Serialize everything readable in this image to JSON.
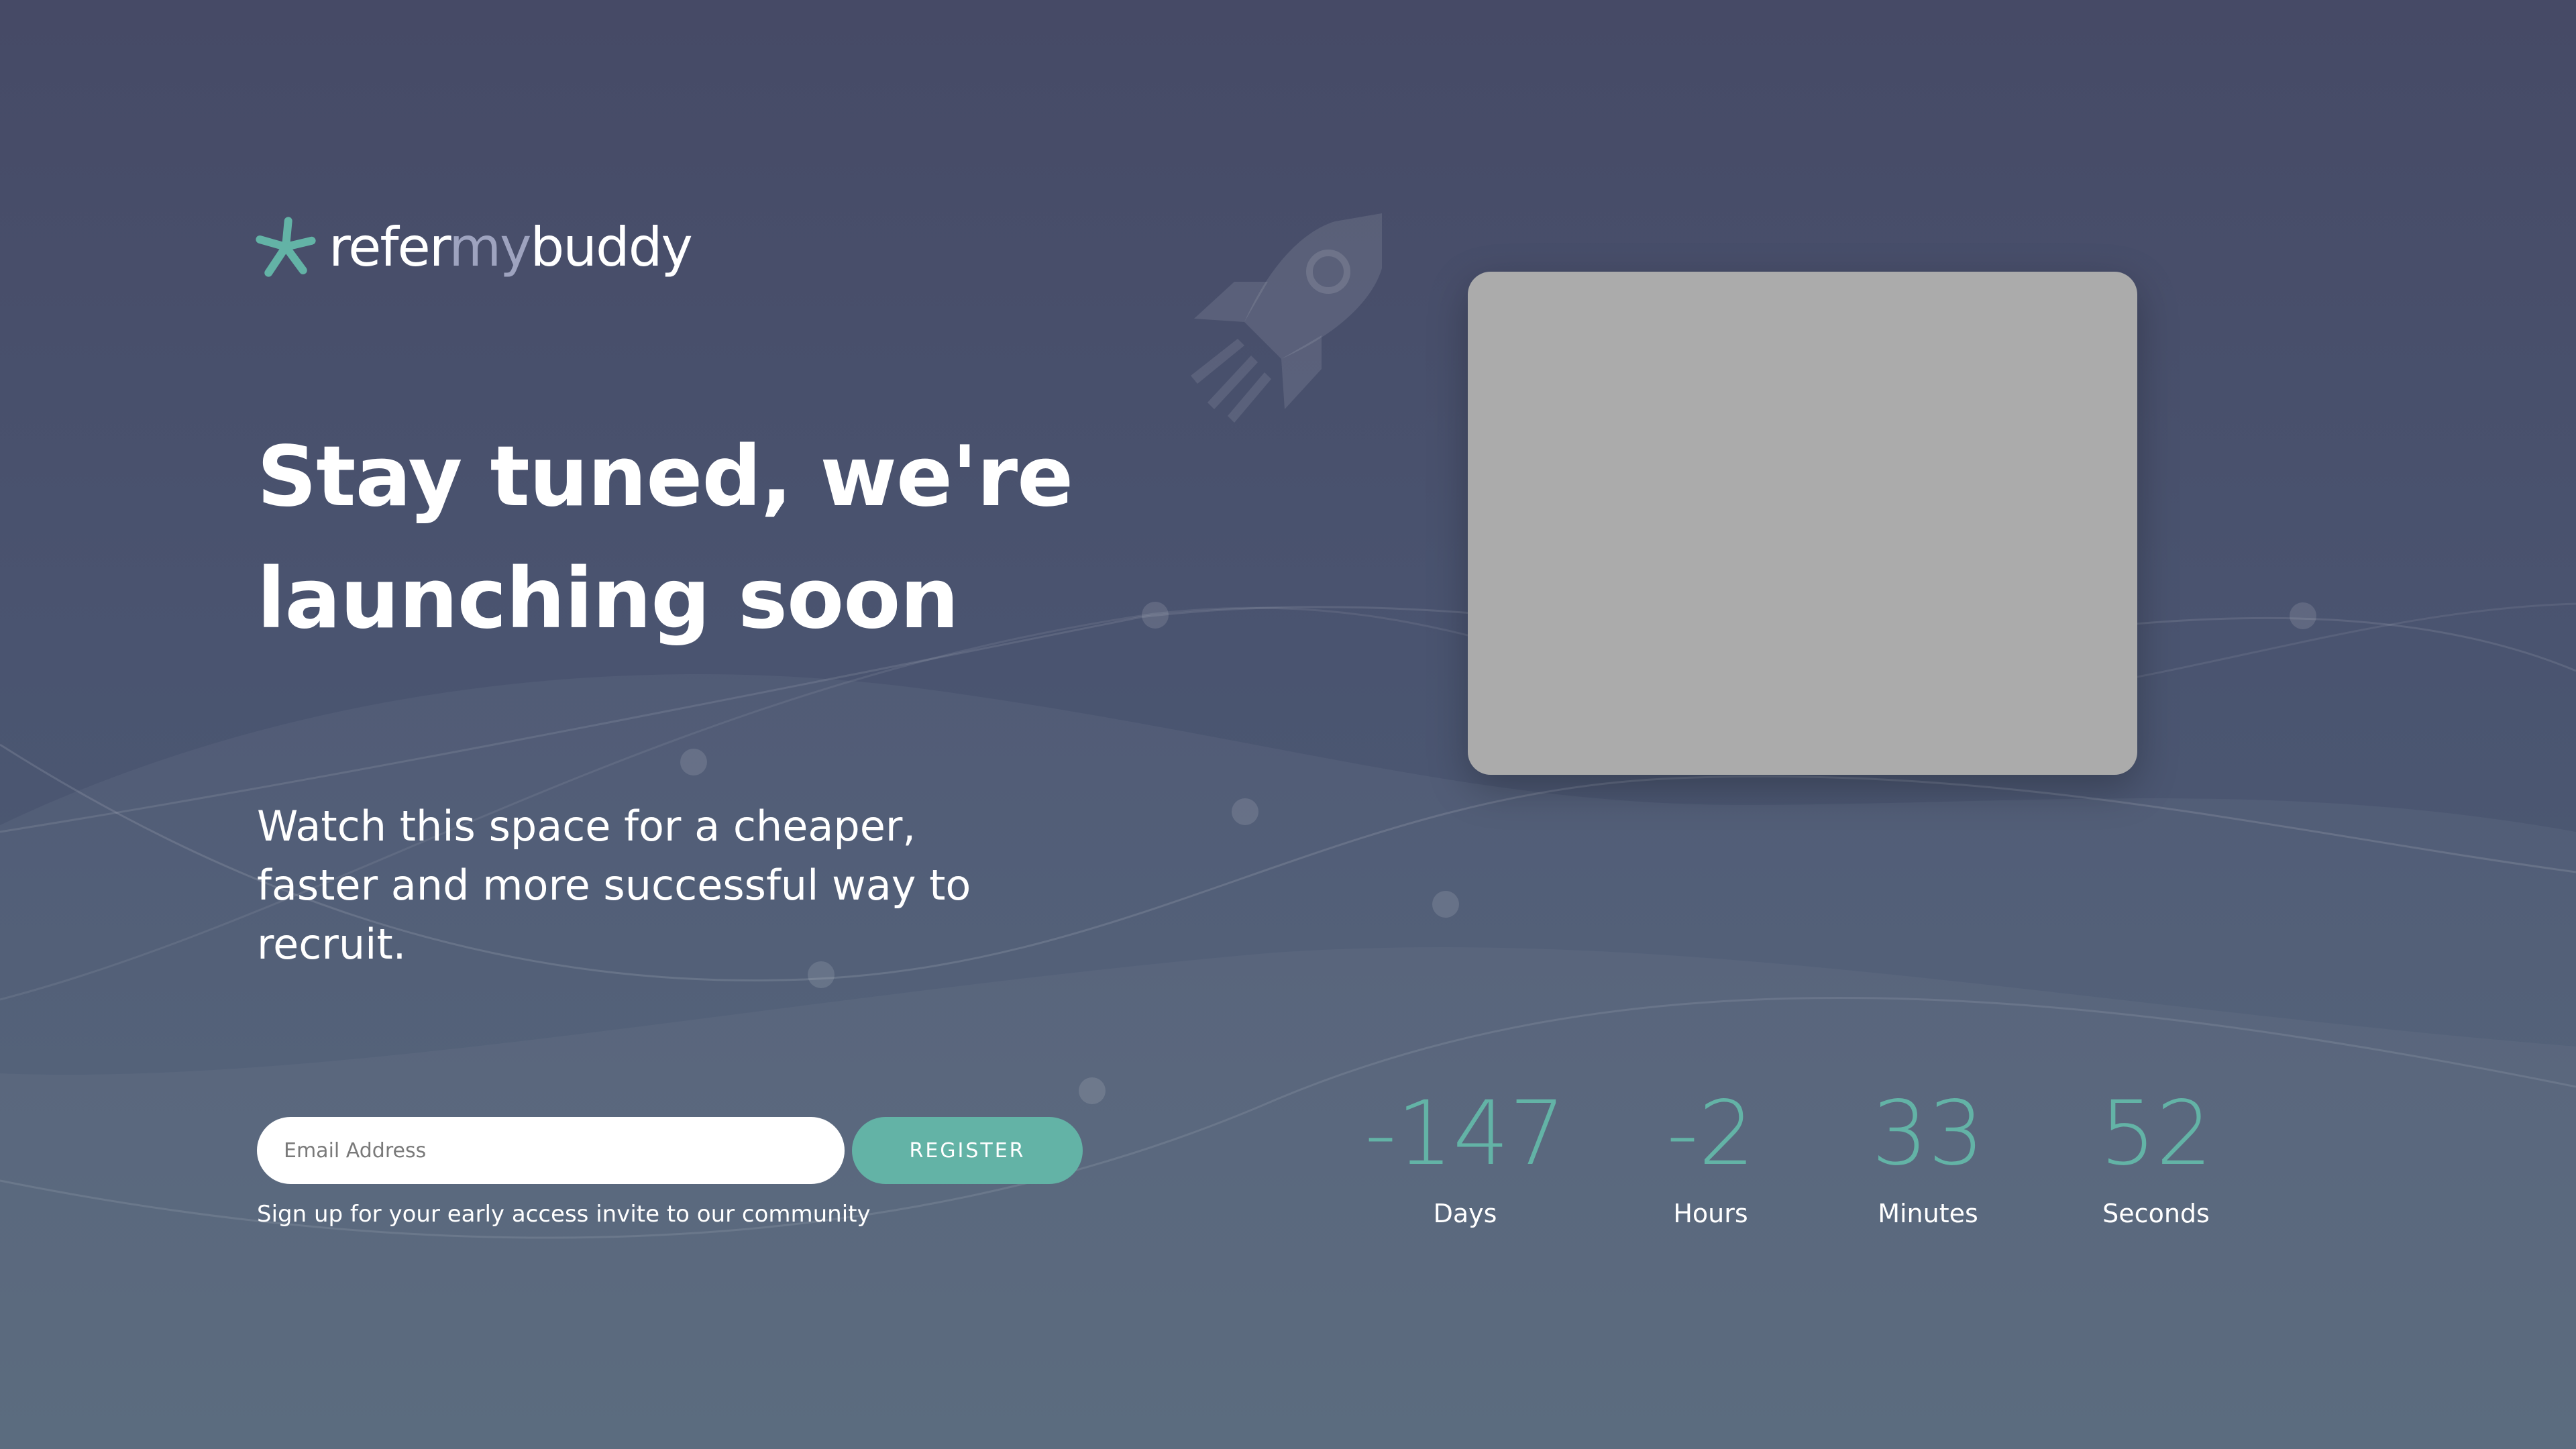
{
  "brand": {
    "name_part1": "refer",
    "name_part2": "my",
    "name_part3": "buddy",
    "primary_color": "#63b3a6",
    "accent_text_color": "#9ea3bf",
    "logo_icon": "asterisk-star-icon"
  },
  "hero": {
    "headline_line1": "Stay tuned, we're",
    "headline_line2": "launching soon",
    "subtext": "Watch this space for a cheaper, faster and more successful way to recruit.",
    "decoration_icon": "rocket-icon"
  },
  "signup": {
    "email_placeholder": "Email Address",
    "email_value": "",
    "register_label": "REGISTER",
    "note": "Sign up for your early access invite to our community"
  },
  "countdown": {
    "units": [
      {
        "value": "-147",
        "label": "Days"
      },
      {
        "value": "-2",
        "label": "Hours"
      },
      {
        "value": "33",
        "label": "Minutes"
      },
      {
        "value": "52",
        "label": "Seconds"
      }
    ]
  },
  "colors": {
    "background_top": "#464a66",
    "background_bottom": "#4f6176",
    "media_placeholder": "#ababab"
  }
}
